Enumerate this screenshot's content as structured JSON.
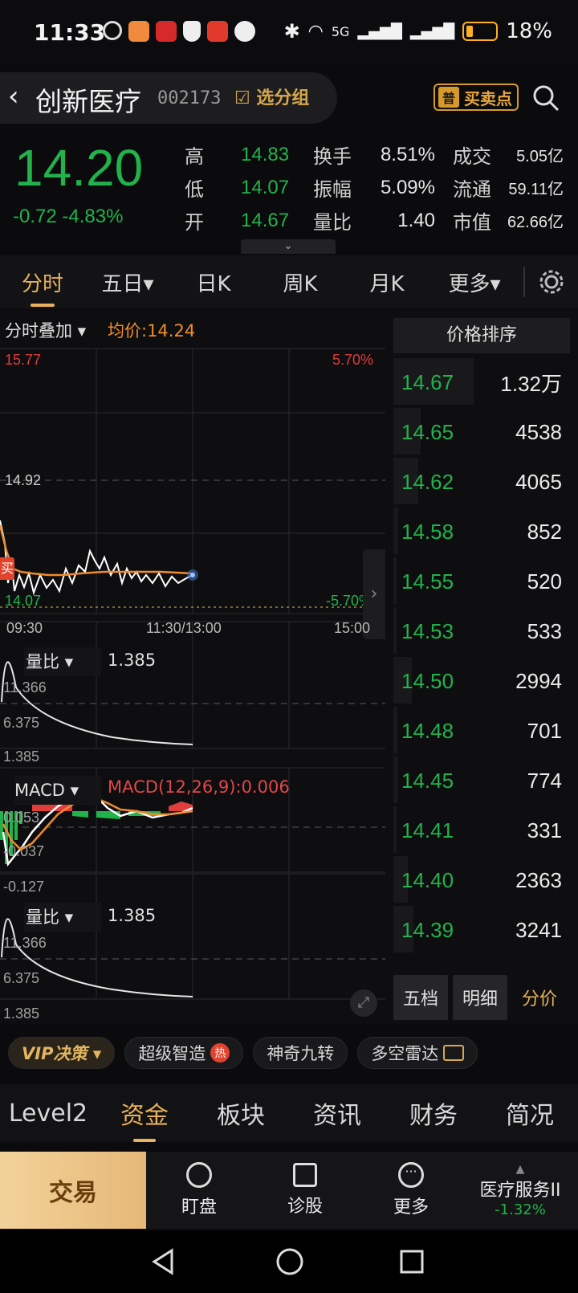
{
  "status_bar": {
    "time": "11:33",
    "battery": "18%",
    "network": "5G"
  },
  "header": {
    "stock_name": "创新医疗",
    "stock_code": "002173",
    "group_button": "选分组",
    "buy_sell_badge": "普",
    "buy_sell_label": "买卖点"
  },
  "quote": {
    "price": "14.20",
    "change": "-0.72 -4.83%",
    "rows": [
      {
        "l1": "高",
        "v1": "14.83",
        "l2": "换手",
        "v2": "8.51%",
        "l3": "成交",
        "v3": "5.05亿"
      },
      {
        "l1": "低",
        "v1": "14.07",
        "l2": "振幅",
        "v2": "5.09%",
        "l3": "流通",
        "v3": "59.11亿"
      },
      {
        "l1": "开",
        "v1": "14.67",
        "l2": "量比",
        "v2": "1.40",
        "l3": "市值",
        "v3": "62.66亿"
      }
    ]
  },
  "tabs": [
    "分时",
    "五日▾",
    "日K",
    "周K",
    "月K",
    "更多▾"
  ],
  "chart": {
    "overlay_label": "分时叠加 ▾",
    "avg_price_label": "均价:14.24",
    "price_top": "15.77",
    "pct_top": "5.70%",
    "price_mid": "14.92",
    "price_bottom": "14.07",
    "pct_bottom": "-5.70%",
    "buy_marker": "买",
    "time_labels": [
      "09:30",
      "11:30/13:00",
      "15:00"
    ],
    "vol_ratio_label": "量比 ▾",
    "vol_ratio_value": "1.385",
    "vr_ticks": [
      "11.366",
      "6.375",
      "1.385"
    ],
    "macd_label": "MACD ▾",
    "macd_value": "MACD(12,26,9):0.006",
    "macd_ticks": [
      "0.053",
      "-0.037",
      "-0.127"
    ],
    "vol_ratio2_label": "量比 ▾",
    "vol_ratio2_value": "1.385",
    "vr2_ticks": [
      "11.366",
      "6.375",
      "1.385"
    ],
    "colors": {
      "up": "#e03d3d",
      "down": "#21b24b",
      "avg": "#ef8c2c",
      "price": "#ffffff"
    }
  },
  "price_ladder": {
    "title": "价格排序",
    "rows": [
      {
        "price": "14.67",
        "vol": "1.32万",
        "level": 1.0
      },
      {
        "price": "14.65",
        "vol": "4538",
        "level": 0.34
      },
      {
        "price": "14.62",
        "vol": "4065",
        "level": 0.31
      },
      {
        "price": "14.58",
        "vol": "852",
        "level": 0.06
      },
      {
        "price": "14.55",
        "vol": "520",
        "level": 0.04
      },
      {
        "price": "14.53",
        "vol": "533",
        "level": 0.04
      },
      {
        "price": "14.50",
        "vol": "2994",
        "level": 0.23
      },
      {
        "price": "14.48",
        "vol": "701",
        "level": 0.05
      },
      {
        "price": "14.45",
        "vol": "774",
        "level": 0.06
      },
      {
        "price": "14.41",
        "vol": "331",
        "level": 0.03
      },
      {
        "price": "14.40",
        "vol": "2363",
        "level": 0.18
      },
      {
        "price": "14.39",
        "vol": "3241",
        "level": 0.25
      }
    ],
    "tabs": [
      "五档",
      "明细",
      "分价"
    ]
  },
  "feature_chips": [
    "VIP决策 ▾",
    "超级智造",
    "神奇九转",
    "多空雷达"
  ],
  "hot_badge": "热",
  "section_tabs": [
    "Level2",
    "资金",
    "板块",
    "资讯",
    "财务",
    "简况"
  ],
  "bottom_bar": {
    "trade": "交易",
    "items": [
      "盯盘",
      "诊股",
      "更多"
    ],
    "sector_name": "医疗服务II",
    "sector_change": "-1.32%"
  }
}
